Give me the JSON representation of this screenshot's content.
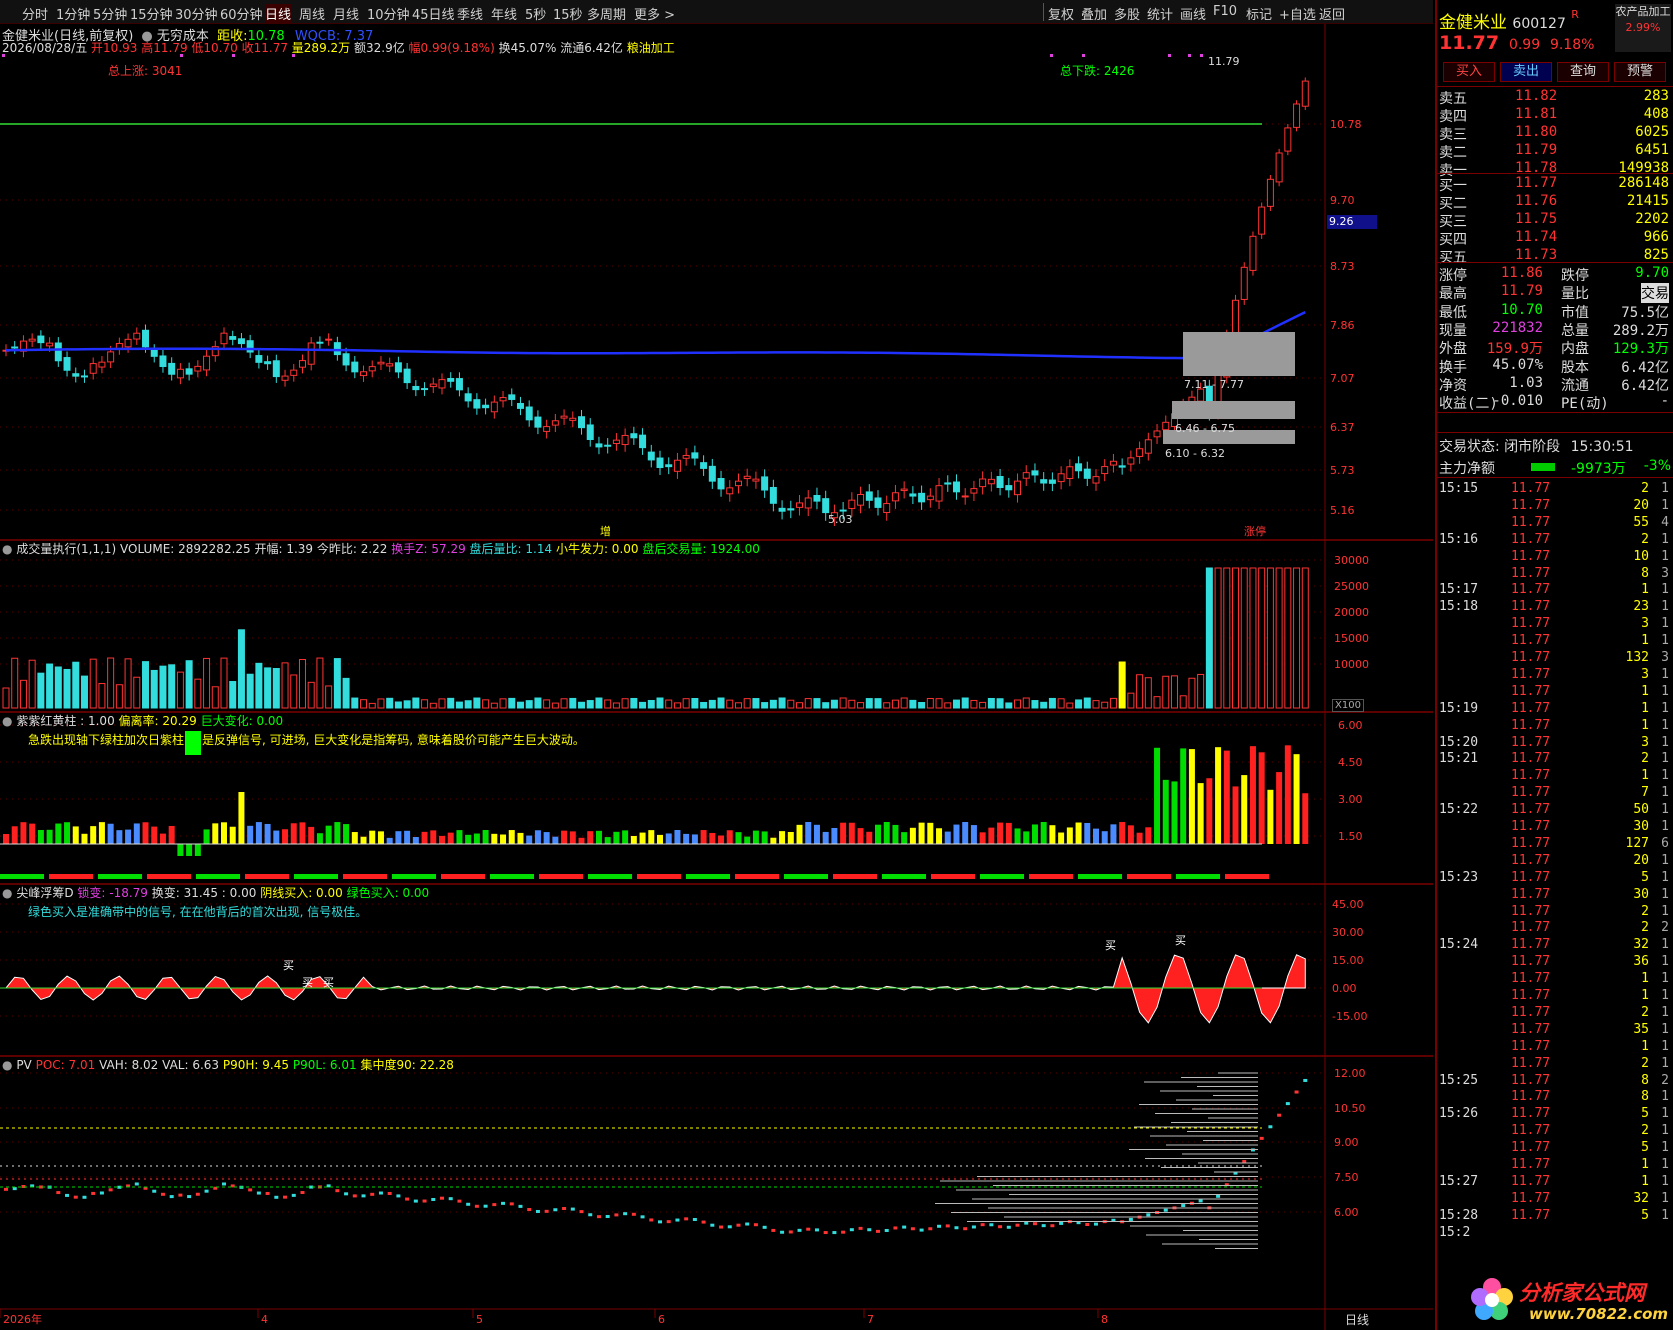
{
  "toolbar": {
    "periods": [
      "分时",
      "1分钟",
      "5分钟",
      "15分钟",
      "30分钟",
      "60分钟",
      "日线",
      "周线",
      "月线",
      "10分钟",
      "45日线",
      "季线",
      "年线",
      "5秒",
      "15秒",
      "多周期",
      "更多 >"
    ],
    "tools": [
      "复权",
      "叠加",
      "多股",
      "统计",
      "画线",
      "F10",
      "标记",
      "+自选",
      "返回"
    ]
  },
  "info": {
    "name": "金健米业(日线,前复权)",
    "indicator": "无穷成本",
    "dist_label": "距收:",
    "dist_val": "10.78",
    "wqcb": "WQCB: 7.37",
    "date": "2026/08/28/五",
    "open": "开10.93",
    "high": "高11.79",
    "low": "低10.70",
    "close": "收11.77",
    "vol": "量289.2万",
    "amt": "额32.9亿",
    "chg": "幅0.99(9.18%)",
    "turn": "换45.07%",
    "float": "流通6.42亿",
    "ind": "粮油加工"
  },
  "price_panel": {
    "up_total": "总上涨: 3041",
    "down_total": "总下跌: 2426",
    "y_labels": [
      "10.78",
      "9.70",
      "8.73",
      "7.86",
      "7.07",
      "6.37",
      "5.73",
      "5.16"
    ],
    "cursor_price": "9.26",
    "annot_high": "11.79",
    "annot_low": "5.03",
    "zones": [
      "7.11 - 7.77",
      "6.46 - 6.75",
      "6.10 - 6.32"
    ],
    "tag_left": "增",
    "tag_right": "涨停"
  },
  "vol_panel": {
    "header": "成交量执行(1,1,1) VOLUME: 2892282.25 开幅: 1.39 今昨比: 2.22",
    "h2": "换手Z: 57.29",
    "h3": "盘后量比: 1.14",
    "h4": "小牛发力: 0.00",
    "h5": "盘后交易量: 1924.00",
    "y_labels": [
      "30000",
      "25000",
      "20000",
      "15000",
      "10000"
    ],
    "unit": "X100"
  },
  "purple_panel": {
    "header": "紫紫红黄柱 : 1.00",
    "h2": "偏离率: 20.29",
    "h3": "巨大变化: 0.00",
    "note1": "急跌出现轴下绿柱加次日紫柱",
    "note2": "是反弹信号, 可进场, 巨大变化是指筹码, 意味着股价可能产生巨大波动。",
    "y_labels": [
      "6.00",
      "4.50",
      "3.00",
      "1.50"
    ]
  },
  "peak_panel": {
    "header": "尖峰浮筹D",
    "h2": "锁变: -18.79",
    "h3": "换变: 31.45 : 0.00",
    "h4": "阴线买入: 0.00",
    "h5": "绿色买入: 0.00",
    "note": "绿色买入是准确带中的信号, 在在他背后的首次出现, 信号极佳。",
    "y_labels": [
      "45.00",
      "30.00",
      "15.00",
      "0.00",
      "-15.00"
    ],
    "buy_label": "买"
  },
  "pv_panel": {
    "header": "PV",
    "poc": "POC: 7.01",
    "vah": "VAH: 8.02",
    "val": "VAL: 6.63",
    "p90h": "P90H: 9.45",
    "p90l": "P90L: 6.01",
    "conc": "集中度90: 22.28",
    "y_labels": [
      "12.00",
      "10.50",
      "9.00",
      "7.50",
      "6.00"
    ]
  },
  "xaxis": {
    "labels": [
      "2026年",
      "4",
      "5",
      "6",
      "7",
      "8"
    ],
    "mode": "日线"
  },
  "quote": {
    "name": "金健米业",
    "code": "600127",
    "mark": "R",
    "sector": "农产品加工",
    "sector_chg": "2.99%",
    "price": "11.77",
    "chg": "0.99",
    "pct": "9.18%",
    "buttons": [
      "买入",
      "卖出",
      "查询",
      "预警"
    ],
    "asks": [
      {
        "l": "卖五",
        "p": "11.82",
        "v": "283"
      },
      {
        "l": "卖四",
        "p": "11.81",
        "v": "408"
      },
      {
        "l": "卖三",
        "p": "11.80",
        "v": "6025"
      },
      {
        "l": "卖二",
        "p": "11.79",
        "v": "6451"
      },
      {
        "l": "卖一",
        "p": "11.78",
        "v": "149938"
      }
    ],
    "bids": [
      {
        "l": "买一",
        "p": "11.77",
        "v": "286148"
      },
      {
        "l": "买二",
        "p": "11.76",
        "v": "21415"
      },
      {
        "l": "买三",
        "p": "11.75",
        "v": "2202"
      },
      {
        "l": "买四",
        "p": "11.74",
        "v": "966"
      },
      {
        "l": "买五",
        "p": "11.73",
        "v": "825"
      }
    ],
    "stats": [
      [
        "涨停",
        "11.86",
        "跌停",
        "9.70"
      ],
      [
        "最高",
        "11.79",
        "量比",
        "交易"
      ],
      [
        "最低",
        "10.70",
        "市值",
        "75.5亿"
      ],
      [
        "现量",
        "221832",
        "总量",
        "289.2万"
      ],
      [
        "外盘",
        "159.9万",
        "内盘",
        "129.3万"
      ],
      [
        "换手",
        "45.07%",
        "股本",
        "6.42亿"
      ],
      [
        "净资",
        "1.03",
        "流通",
        "6.42亿"
      ],
      [
        "收益(二)",
        "-0.010",
        "PE(动)",
        "-"
      ]
    ],
    "status_label": "交易状态:",
    "status": "闭市阶段",
    "status_time": "15:30:51",
    "net_label": "主力净额",
    "net_val": "-9973万",
    "net_pct": "-3%"
  },
  "ticks": [
    [
      "15:15",
      "11.77",
      "2",
      "1"
    ],
    [
      "",
      "11.77",
      "20",
      "1"
    ],
    [
      "",
      "11.77",
      "55",
      "4"
    ],
    [
      "15:16",
      "11.77",
      "2",
      "1"
    ],
    [
      "",
      "11.77",
      "10",
      "1"
    ],
    [
      "",
      "11.77",
      "8",
      "3"
    ],
    [
      "15:17",
      "11.77",
      "1",
      "1"
    ],
    [
      "15:18",
      "11.77",
      "23",
      "1"
    ],
    [
      "",
      "11.77",
      "3",
      "1"
    ],
    [
      "",
      "11.77",
      "1",
      "1"
    ],
    [
      "",
      "11.77",
      "132",
      "3"
    ],
    [
      "",
      "11.77",
      "3",
      "1"
    ],
    [
      "",
      "11.77",
      "1",
      "1"
    ],
    [
      "15:19",
      "11.77",
      "1",
      "1"
    ],
    [
      "",
      "11.77",
      "1",
      "1"
    ],
    [
      "15:20",
      "11.77",
      "3",
      "1"
    ],
    [
      "15:21",
      "11.77",
      "2",
      "1"
    ],
    [
      "",
      "11.77",
      "1",
      "1"
    ],
    [
      "",
      "11.77",
      "7",
      "1"
    ],
    [
      "15:22",
      "11.77",
      "50",
      "1"
    ],
    [
      "",
      "11.77",
      "30",
      "1"
    ],
    [
      "",
      "11.77",
      "127",
      "6"
    ],
    [
      "",
      "11.77",
      "20",
      "1"
    ],
    [
      "15:23",
      "11.77",
      "5",
      "1"
    ],
    [
      "",
      "11.77",
      "30",
      "1"
    ],
    [
      "",
      "11.77",
      "2",
      "1"
    ],
    [
      "",
      "11.77",
      "2",
      "2"
    ],
    [
      "15:24",
      "11.77",
      "32",
      "1"
    ],
    [
      "",
      "11.77",
      "36",
      "1"
    ],
    [
      "",
      "11.77",
      "1",
      "1"
    ],
    [
      "",
      "11.77",
      "1",
      "1"
    ],
    [
      "",
      "11.77",
      "2",
      "1"
    ],
    [
      "",
      "11.77",
      "35",
      "1"
    ],
    [
      "",
      "11.77",
      "1",
      "1"
    ],
    [
      "",
      "11.77",
      "2",
      "1"
    ],
    [
      "15:25",
      "11.77",
      "8",
      "2"
    ],
    [
      "",
      "11.77",
      "8",
      "1"
    ],
    [
      "15:26",
      "11.77",
      "5",
      "1"
    ],
    [
      "",
      "11.77",
      "2",
      "1"
    ],
    [
      "",
      "11.77",
      "5",
      "1"
    ],
    [
      "",
      "11.77",
      "1",
      "1"
    ],
    [
      "15:27",
      "11.77",
      "1",
      "1"
    ],
    [
      "",
      "11.77",
      "32",
      "1"
    ],
    [
      "15:28",
      "11.77",
      "5",
      "1"
    ],
    [
      "15:2",
      "",
      "",
      " "
    ]
  ],
  "logo": {
    "text": "分析家公式网",
    "url": "www.70822.com"
  },
  "colors": {
    "up": "#ff3333",
    "down": "#33dddd",
    "green": "#00ff00",
    "yellow": "#ffff00",
    "purple": "#e040e0",
    "blue": "#2030ff",
    "frame": "#7a0000"
  }
}
